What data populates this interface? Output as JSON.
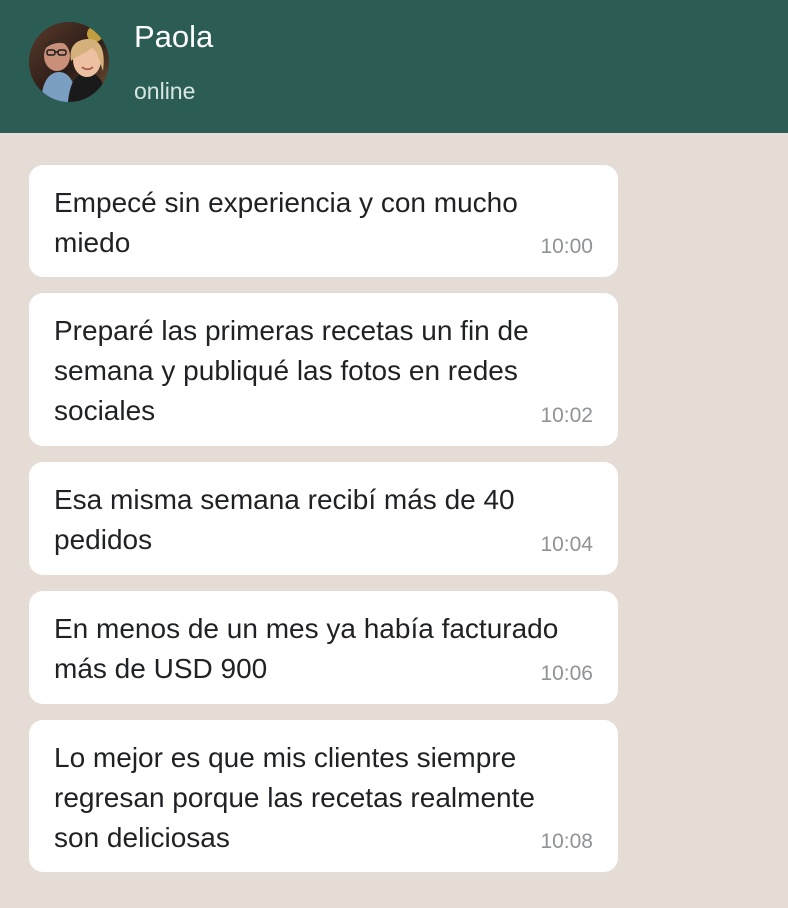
{
  "header": {
    "contact_name": "Paola",
    "status": "online",
    "background_color": "#2b5d54"
  },
  "messages": [
    {
      "text": "Empecé sin experiencia y con mucho miedo",
      "time": "10:00"
    },
    {
      "text": "Preparé las primeras recetas un fin de semana y publiqué las fotos en redes sociales",
      "time": "10:02"
    },
    {
      "text": "Esa misma semana recibí más de 40 pedidos",
      "time": "10:04"
    },
    {
      "text": "En menos de un mes ya había facturado más de USD 900",
      "time": "10:06"
    },
    {
      "text": "Lo mejor es que mis clientes siempre regresan porque las recetas realmente son deliciosas",
      "time": "10:08"
    }
  ],
  "theme": {
    "chat_background": "#e5ddd5",
    "bubble_background": "#ffffff",
    "timestamp_color": "#8f9396"
  }
}
